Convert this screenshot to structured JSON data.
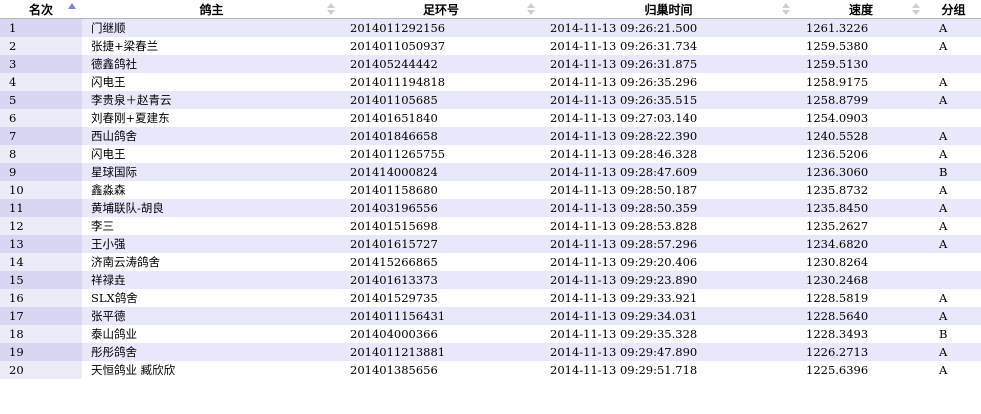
{
  "columns": [
    {
      "key": "rank",
      "label": "名次",
      "sort": "asc"
    },
    {
      "key": "owner",
      "label": "鸽主",
      "sort": "none"
    },
    {
      "key": "ring",
      "label": "足环号",
      "sort": "none"
    },
    {
      "key": "time",
      "label": "归巢时间",
      "sort": "none"
    },
    {
      "key": "speed",
      "label": "速度",
      "sort": "none"
    },
    {
      "key": "group",
      "label": "分组",
      "sort": "none"
    }
  ],
  "colors": {
    "row_odd": "#e8e8fb",
    "row_even": "#ffffff",
    "rank_odd": "#d7d7f3",
    "rank_even": "#ececf8",
    "sort_active": "#7a86d8",
    "sort_inactive": "#cfcfcf"
  },
  "rows": [
    {
      "rank": "1",
      "owner": "门继顺",
      "ring": "2014011292156",
      "time": "2014-11-13 09:26:21.500",
      "speed": "1261.3226",
      "group": "A"
    },
    {
      "rank": "2",
      "owner": "张捷+梁春兰",
      "ring": "2014011050937",
      "time": "2014-11-13 09:26:31.734",
      "speed": "1259.5380",
      "group": "A"
    },
    {
      "rank": "3",
      "owner": "德鑫鸽社",
      "ring": "201405244442",
      "time": "2014-11-13 09:26:31.875",
      "speed": "1259.5130",
      "group": ""
    },
    {
      "rank": "4",
      "owner": "闪电王",
      "ring": "2014011194818",
      "time": "2014-11-13 09:26:35.296",
      "speed": "1258.9175",
      "group": "A"
    },
    {
      "rank": "5",
      "owner": "李贵泉＋赵青云",
      "ring": "201401105685",
      "time": "2014-11-13 09:26:35.515",
      "speed": "1258.8799",
      "group": "A"
    },
    {
      "rank": "6",
      "owner": "刘春刚+夏建东",
      "ring": "201401651840",
      "time": "2014-11-13 09:27:03.140",
      "speed": "1254.0903",
      "group": ""
    },
    {
      "rank": "7",
      "owner": "西山鸽舍",
      "ring": "201401846658",
      "time": "2014-11-13 09:28:22.390",
      "speed": "1240.5528",
      "group": "A"
    },
    {
      "rank": "8",
      "owner": "闪电王",
      "ring": "2014011265755",
      "time": "2014-11-13 09:28:46.328",
      "speed": "1236.5206",
      "group": "A"
    },
    {
      "rank": "9",
      "owner": "星球国际",
      "ring": "201414000824",
      "time": "2014-11-13 09:28:47.609",
      "speed": "1236.3060",
      "group": "B"
    },
    {
      "rank": "10",
      "owner": "鑫淼森",
      "ring": "201401158680",
      "time": "2014-11-13 09:28:50.187",
      "speed": "1235.8732",
      "group": "A"
    },
    {
      "rank": "11",
      "owner": "黄埔联队-胡良",
      "ring": "201403196556",
      "time": "2014-11-13 09:28:50.359",
      "speed": "1235.8450",
      "group": "A"
    },
    {
      "rank": "12",
      "owner": "李三",
      "ring": "201401515698",
      "time": "2014-11-13 09:28:53.828",
      "speed": "1235.2627",
      "group": "A"
    },
    {
      "rank": "13",
      "owner": "王小强",
      "ring": "201401615727",
      "time": "2014-11-13 09:28:57.296",
      "speed": "1234.6820",
      "group": "A"
    },
    {
      "rank": "14",
      "owner": "济南云涛鸽舍",
      "ring": "201415266865",
      "time": "2014-11-13 09:29:20.406",
      "speed": "1230.8264",
      "group": ""
    },
    {
      "rank": "15",
      "owner": "祥禄垚",
      "ring": "201401613373",
      "time": "2014-11-13 09:29:23.890",
      "speed": "1230.2468",
      "group": ""
    },
    {
      "rank": "16",
      "owner": "SLX鸽舍",
      "ring": "201401529735",
      "time": "2014-11-13 09:29:33.921",
      "speed": "1228.5819",
      "group": "A"
    },
    {
      "rank": "17",
      "owner": "张平德",
      "ring": "2014011156431",
      "time": "2014-11-13 09:29:34.031",
      "speed": "1228.5640",
      "group": "A"
    },
    {
      "rank": "18",
      "owner": "泰山鸽业",
      "ring": "201404000366",
      "time": "2014-11-13 09:29:35.328",
      "speed": "1228.3493",
      "group": "B"
    },
    {
      "rank": "19",
      "owner": "彤彤鸽舍",
      "ring": "2014011213881",
      "time": "2014-11-13 09:29:47.890",
      "speed": "1226.2713",
      "group": "A"
    },
    {
      "rank": "20",
      "owner": "天恒鸽业 臧欣欣",
      "ring": "201401385656",
      "time": "2014-11-13 09:29:51.718",
      "speed": "1225.6396",
      "group": "A"
    }
  ]
}
